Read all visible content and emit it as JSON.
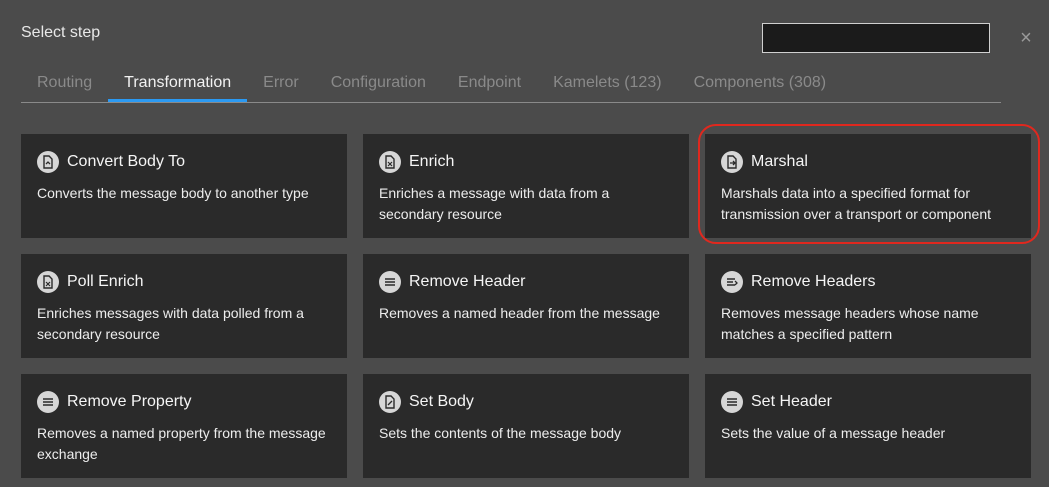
{
  "dialog": {
    "title": "Select step",
    "close_label": "×",
    "search_value": ""
  },
  "tabs": [
    {
      "label": "Routing",
      "active": false
    },
    {
      "label": "Transformation",
      "active": true
    },
    {
      "label": "Error",
      "active": false
    },
    {
      "label": "Configuration",
      "active": false
    },
    {
      "label": "Endpoint",
      "active": false
    },
    {
      "label": "Kamelets (123)",
      "active": false
    },
    {
      "label": "Components (308)",
      "active": false
    }
  ],
  "cards": [
    {
      "title": "Convert Body To",
      "description": "Converts the message body to another type",
      "icon": "document-convert-icon"
    },
    {
      "title": "Enrich",
      "description": "Enriches a message with data from a secondary resource",
      "icon": "document-enrich-icon"
    },
    {
      "title": "Marshal",
      "description": "Marshals data into a specified format for transmission over a transport or component",
      "icon": "document-marshal-icon"
    },
    {
      "title": "Poll Enrich",
      "description": "Enriches messages with data polled from a secondary resource",
      "icon": "document-enrich-icon"
    },
    {
      "title": "Remove Header",
      "description": "Removes a named header from the message",
      "icon": "list-remove-icon"
    },
    {
      "title": "Remove Headers",
      "description": "Removes message headers whose name matches a specified pattern",
      "icon": "list-remove-icon"
    },
    {
      "title": "Remove Property",
      "description": "Removes a named property from the message exchange",
      "icon": "list-remove-icon"
    },
    {
      "title": "Set Body",
      "description": "Sets the contents of the message body",
      "icon": "document-set-icon"
    },
    {
      "title": "Set Header",
      "description": "Sets the value of a message header",
      "icon": "list-set-icon"
    }
  ],
  "colors": {
    "accent": "#2b9af3",
    "highlight": "#e0281e",
    "card_bg": "#2a2a2a"
  }
}
